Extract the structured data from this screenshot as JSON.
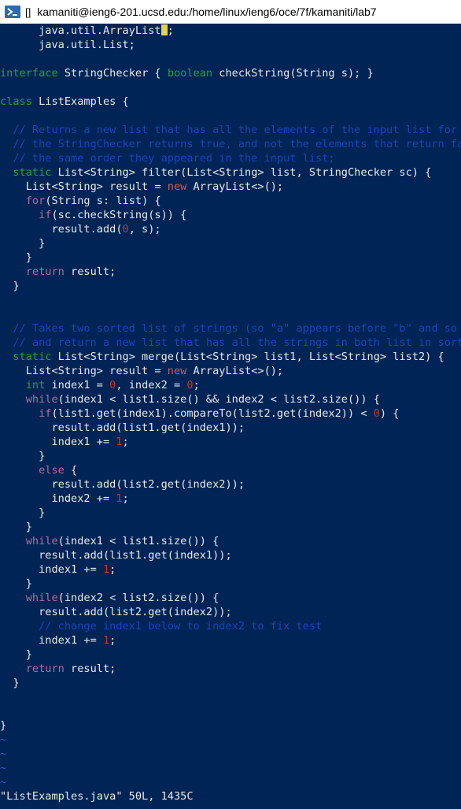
{
  "window": {
    "title": "kamaniti@ieng6-201.ucsd.edu:/home/linux/ieng6/oce/7f/kamaniti/lab7",
    "bracket": "[]"
  },
  "editor": {
    "lines": [
      [
        {
          "t": "      java.util.ArrayList"
        },
        {
          "t": ";",
          "c": "cursor-after"
        }
      ],
      [
        {
          "t": "      java.util.List;"
        }
      ],
      [
        {
          "t": ""
        }
      ],
      [
        {
          "t": "interface",
          "c": "kw"
        },
        {
          "t": " StringChecker { "
        },
        {
          "t": "boolean",
          "c": "ty"
        },
        {
          "t": " checkString(String s); }"
        }
      ],
      [
        {
          "t": ""
        }
      ],
      [
        {
          "t": "class",
          "c": "kw"
        },
        {
          "t": " ListExamples {"
        }
      ],
      [
        {
          "t": ""
        }
      ],
      [
        {
          "t": "  // Returns a new list that has all the elements of the input list for wh",
          "c": "cm"
        }
      ],
      [
        {
          "t": "  // the StringChecker returns true, and not the elements that return fals",
          "c": "cm"
        }
      ],
      [
        {
          "t": "  // the same order they appeared in the input list;",
          "c": "cm"
        }
      ],
      [
        {
          "t": "  "
        },
        {
          "t": "static",
          "c": "kw"
        },
        {
          "t": " List<String> filter(List<String> list, StringChecker sc) {"
        }
      ],
      [
        {
          "t": "    List<String> result = "
        },
        {
          "t": "new",
          "c": "newkw"
        },
        {
          "t": " ArrayList<>();"
        }
      ],
      [
        {
          "t": "    "
        },
        {
          "t": "for",
          "c": "flow"
        },
        {
          "t": "(String s: list) {"
        }
      ],
      [
        {
          "t": "      "
        },
        {
          "t": "if",
          "c": "flow"
        },
        {
          "t": "(sc.checkString(s)) {"
        }
      ],
      [
        {
          "t": "        result.add("
        },
        {
          "t": "0",
          "c": "num"
        },
        {
          "t": ", s);"
        }
      ],
      [
        {
          "t": "      }"
        }
      ],
      [
        {
          "t": "    }"
        }
      ],
      [
        {
          "t": "    "
        },
        {
          "t": "return",
          "c": "flow"
        },
        {
          "t": " result;"
        }
      ],
      [
        {
          "t": "  }"
        }
      ],
      [
        {
          "t": ""
        }
      ],
      [
        {
          "t": ""
        }
      ],
      [
        {
          "t": "  // Takes two sorted list of strings (so \"a\" appears before \"b\" and so on",
          "c": "cm"
        }
      ],
      [
        {
          "t": "  // and return a new list that has all the strings in both list in sorted",
          "c": "cm"
        }
      ],
      [
        {
          "t": "  "
        },
        {
          "t": "static",
          "c": "kw"
        },
        {
          "t": " List<String> merge(List<String> list1, List<String> list2) {"
        }
      ],
      [
        {
          "t": "    List<String> result = "
        },
        {
          "t": "new",
          "c": "newkw"
        },
        {
          "t": " ArrayList<>();"
        }
      ],
      [
        {
          "t": "    "
        },
        {
          "t": "int",
          "c": "ty"
        },
        {
          "t": " index1 = "
        },
        {
          "t": "0",
          "c": "num"
        },
        {
          "t": ", index2 = "
        },
        {
          "t": "0",
          "c": "num"
        },
        {
          "t": ";"
        }
      ],
      [
        {
          "t": "    "
        },
        {
          "t": "while",
          "c": "flow"
        },
        {
          "t": "(index1 < list1.size() && index2 < list2.size()) {"
        }
      ],
      [
        {
          "t": "      "
        },
        {
          "t": "if",
          "c": "flow"
        },
        {
          "t": "(list1.get(index1).compareTo(list2.get(index2)) < "
        },
        {
          "t": "0",
          "c": "num"
        },
        {
          "t": ") {"
        }
      ],
      [
        {
          "t": "        result.add(list1.get(index1));"
        }
      ],
      [
        {
          "t": "        index1 += "
        },
        {
          "t": "1",
          "c": "num"
        },
        {
          "t": ";"
        }
      ],
      [
        {
          "t": "      }"
        }
      ],
      [
        {
          "t": "      "
        },
        {
          "t": "else",
          "c": "flow"
        },
        {
          "t": " {"
        }
      ],
      [
        {
          "t": "        result.add(list2.get(index2));"
        }
      ],
      [
        {
          "t": "        index2 += "
        },
        {
          "t": "1",
          "c": "num"
        },
        {
          "t": ";"
        }
      ],
      [
        {
          "t": "      }"
        }
      ],
      [
        {
          "t": "    }"
        }
      ],
      [
        {
          "t": "    "
        },
        {
          "t": "while",
          "c": "flow"
        },
        {
          "t": "(index1 < list1.size()) {"
        }
      ],
      [
        {
          "t": "      result.add(list1.get(index1));"
        }
      ],
      [
        {
          "t": "      index1 += "
        },
        {
          "t": "1",
          "c": "num"
        },
        {
          "t": ";"
        }
      ],
      [
        {
          "t": "    }"
        }
      ],
      [
        {
          "t": "    "
        },
        {
          "t": "while",
          "c": "flow"
        },
        {
          "t": "(index2 < list2.size()) {"
        }
      ],
      [
        {
          "t": "      result.add(list2.get(index2));"
        }
      ],
      [
        {
          "t": "      // change index1 below to index2 to fix test",
          "c": "cm"
        }
      ],
      [
        {
          "t": "      index1 += "
        },
        {
          "t": "1",
          "c": "num"
        },
        {
          "t": ";"
        }
      ],
      [
        {
          "t": "    }"
        }
      ],
      [
        {
          "t": "    "
        },
        {
          "t": "return",
          "c": "flow"
        },
        {
          "t": " result;"
        }
      ],
      [
        {
          "t": "  }"
        }
      ],
      [
        {
          "t": ""
        }
      ],
      [
        {
          "t": ""
        }
      ],
      [
        {
          "t": "}"
        }
      ],
      [
        {
          "t": "~",
          "c": "tilde"
        }
      ],
      [
        {
          "t": "~",
          "c": "tilde"
        }
      ],
      [
        {
          "t": "~",
          "c": "tilde"
        }
      ],
      [
        {
          "t": "~",
          "c": "tilde"
        }
      ]
    ]
  },
  "status": {
    "text": "\"ListExamples.java\" 50L, 1435C"
  },
  "colors": {
    "background": "#012456",
    "keyword": "#21a33b",
    "control_flow": "#b46d9a",
    "new_keyword": "#cd5c5c",
    "number": "#c0392b",
    "comment": "#1a44b8",
    "cursor": "#e8d24a"
  },
  "icons": {
    "app": "powershell-icon"
  }
}
